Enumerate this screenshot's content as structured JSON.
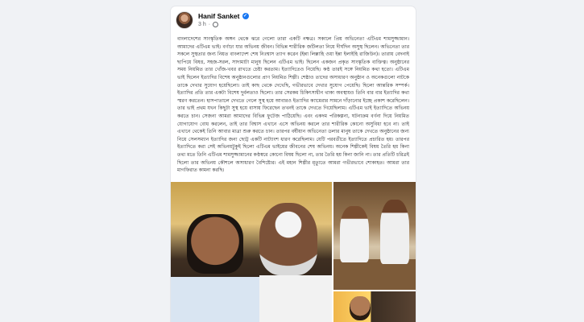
{
  "post": {
    "author": "Hanif Sanket",
    "timestamp": "3 h",
    "separator": "·",
    "verified_mark": "✓",
    "body": "বাংলাদেশের সাংস্কৃতিক অঙ্গন থেকে ঝরে গেলো তারা একটি নক্ষত্র। সকালে প্রিয় অভিনেতা এটিএম শামসুজ্জামান। আমাদের এটিএম ভাই। বর্ণাঢ্য যার অভিনয় জীবন। বিভিন্ন শারীরিক জটিলতা নিয়ে দীর্ঘদিন অসুস্থ ছিলেন। অভিনেতা তার সকলে সুস্থতার জন্য নিয়ত বাংলাদেশ শেষ নিঃশ্বাস ত্যাগ করেন (ইন্না লিল্লাহি ওয়া ইন্না ইলাইহি রাজিউন)। তারায় বেদনাই ছাপিয়ে বিষণ্ণ, সহজ-সরল, সাদামাটা মানুষ ছিলেন এটিএম ভাই। ছিলেন একজন প্রকৃত সাংস্কৃতিক ব্যক্তিত্ব। অনুষ্ঠানের সময় নিয়মিত তার খোঁজ-খবর রাখতে চেষ্টা করতাম। ইত্যাদিতেও নিয়েছি। কণ্ঠ তারই সঙ্গে নিয়মিত কথা হতো। এটিএম ভাই ছিলেন ইত্যাদির বিশেষ অনুষ্ঠানগুলোর প্রাণ নিয়মিত শিল্পী। শেষ্ঠাও তাদের অসাধারণ অনুষ্ঠান ও অনেকগুলো নাটকে তাকে দেখার সুযোগ হয়েছিলো। তাই কাছ থেকে দেখেছি, গভীরভাবে দেখার সুযোগ পেয়েছি। ছিলো আন্তরিক সম্পর্ক। ইত্যাদির প্রতি তার একটা বিশেষ দুর্বলতাও ছিলো। তার সেরকম চিকিৎসাধীন থাকা অবস্থায়ও তিনি বার বার ইত্যাদির কথা স্মরণ করতেন। হাসপাতালে দেখতে গেলে সুস্থ হয়ে আবারও ইত্যাদির ক্যামেরার সামনে দাঁড়ানোর ইচ্ছে প্রকাশ করেছিলেন। তার ভাই প্রথম যখন কিছুটা সুস্থ হয়ে বাসায় ফিরেছেন তখনই তাকে দেখতে গিয়েছিলাম। এটিএম ভাই ইত্যাদিতে অভিনয় করতে চান। সেজন্য আমরা আমাদের বিভিন্ন ফুটেজ পাঠিয়েছি। এবং একদম পরিকল্পনা, ঘটনাক্রম বর্ণনা দিয়ে নিয়মিত যোগাযোগ বোধ করলেন, তাই তার বিশ্বাস এখানে এসে অভিনয় করলে তার শারীরিক কোনো অসুবিধা হবে না। তাই এখানে থেকেই তিনি আবার মাত্রা শুরু করতে চান। তারপর বর্ষীয়ান অভিনেতা ডলার মানুষ তাকে দেখতে অনুষ্ঠানের জন্য নিয়ে সেলসম্যান ইত্যাদির জন্য ছোট্ট একটি নাট্যাংশ ধারণ করেছিলাম। যেটি পরবর্তীতে ইত্যাদিতে প্রচারিত হয়। তারপর ইত্যাদিতে করা সেই অভিনয়টুকুই ছিলো এটিএম ভাইয়ের জীবনের শেষ অভিনয়। অনেক শিল্পীকেই বিষয় তৈরি হয় কিনা তথ্য মতে তিনি এটিএম শামসুজ্জামানের কণ্ঠস্বরে কোনো বিষয় ছিলো না, তার তৈরি হয় কিনা জানি না। তার প্রতিটি চরিত্রই ছিলো তার অভিনয় কৌশলে অসাধারণ বৈশিষ্ট্যের। এই মহান শিল্পীর মৃত্যুতে আমরা গভীরভাবে শোকাহত। আমরা তার মাগফিরাত কামনা করছি।"
  },
  "photos": {
    "count": 3
  }
}
